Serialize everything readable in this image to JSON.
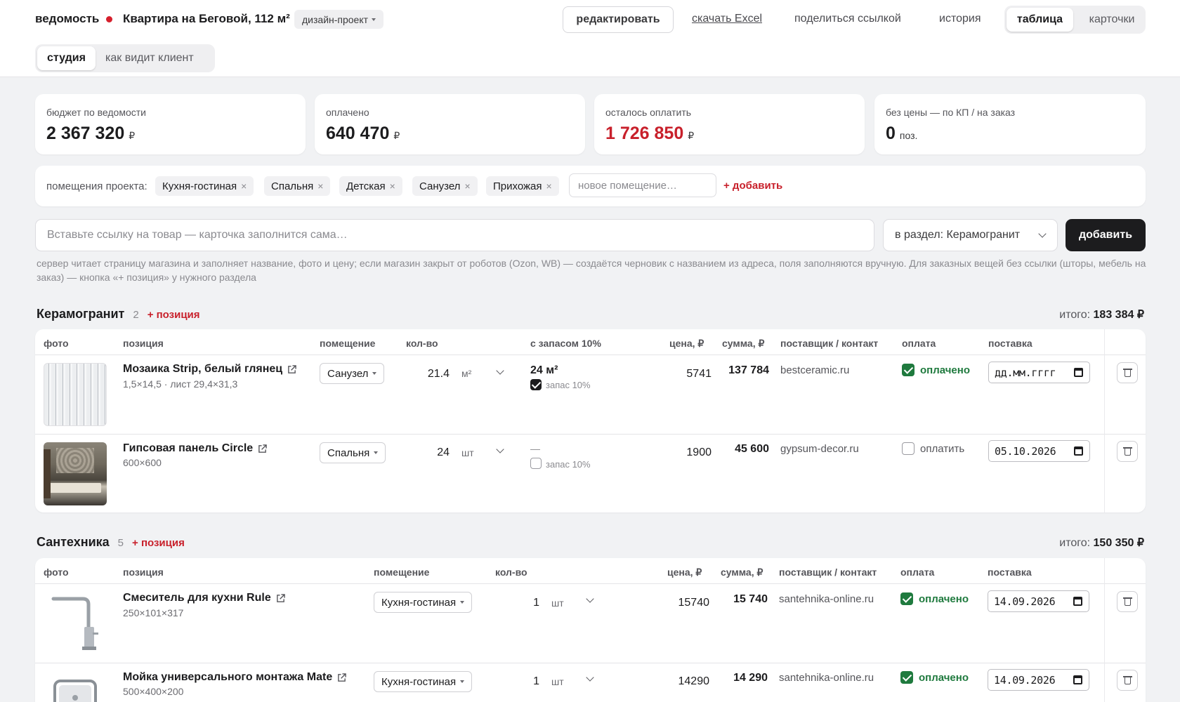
{
  "header": {
    "brand": "ведомость",
    "project_title": "Квартира на Беговой, 112 м²",
    "stage": "дизайн-проект",
    "edit_label": "редактировать",
    "excel_label": "скачать Excel",
    "share_label": "поделиться ссылкой",
    "history_label": "история",
    "view_table": "таблица",
    "view_cards": "карточки",
    "mode_studio": "студия",
    "mode_client": "как видит клиент"
  },
  "stats": [
    {
      "label": "бюджет по ведомости",
      "value": "2 367 320",
      "unit": "₽"
    },
    {
      "label": "оплачено",
      "value": "640 470",
      "unit": "₽"
    },
    {
      "label": "осталось оплатить",
      "value": "1 726 850",
      "unit": "₽"
    },
    {
      "label": "без цены — по КП / на заказ",
      "value": "0",
      "unit": "поз."
    }
  ],
  "rooms": {
    "label": "помещения проекта:",
    "items": [
      "Кухня-гостиная",
      "Спальня",
      "Детская",
      "Санузел",
      "Прихожая"
    ],
    "remove_glyph": "×",
    "new_placeholder": "новое помещение…",
    "add_label": "+ добавить"
  },
  "link_add": {
    "placeholder": "Вставьте ссылку на товар — карточка заполнится сама…",
    "section_select": "в раздел: Керамогранит",
    "add_button": "добавить",
    "hint": "сервер читает страницу магазина и заполняет название, фото и цену; если магазин закрыт от роботов (Ozon, WB) — создаётся черновик с названием из адреса, поля заполняются вручную. Для заказных вещей без ссылки (шторы, мебель на заказ) — кнопка «+ позиция» у нужного раздела"
  },
  "sections": [
    {
      "name": "Керамогранит",
      "count": "2",
      "add_label": "+ позиция",
      "total_label": "итого:",
      "total_value": "183 384 ₽",
      "columns": {
        "photo": "фото",
        "item": "позиция",
        "room": "помещение",
        "qty": "кол-во",
        "reserve": "с запасом 10%",
        "price": "цена, ₽",
        "sum": "сумма, ₽",
        "supplier": "поставщик / контакт",
        "payment": "оплата",
        "delivery": "поставка"
      },
      "rows": [
        {
          "name": "Мозаика Strip, белый глянец",
          "sub": "1,5×14,5 · лист 29,4×31,3",
          "room": "Санузел",
          "qty": "21.4",
          "unit": "м²",
          "reserve": "24 м²",
          "reserve_label": "запас 10%",
          "reserve_checked": true,
          "price": "5741",
          "sum": "137 784",
          "supplier": "bestceramic.ru",
          "paid": true,
          "pay_label": "оплачено",
          "date": "дд.мм.гггг"
        },
        {
          "name": "Гипсовая панель Circle",
          "sub": "600×600",
          "room": "Спальня",
          "qty": "24",
          "unit": "шт",
          "reserve": "—",
          "reserve_label": "запас 10%",
          "reserve_checked": false,
          "price": "1900",
          "sum": "45 600",
          "supplier": "gypsum-decor.ru",
          "paid": false,
          "pay_label": "оплатить",
          "date": "05.10.2026"
        }
      ]
    },
    {
      "name": "Сантехника",
      "count": "5",
      "add_label": "+ позиция",
      "total_label": "итого:",
      "total_value": "150 350 ₽",
      "columns": {
        "photo": "фото",
        "item": "позиция",
        "room": "помещение",
        "qty": "кол-во",
        "price": "цена, ₽",
        "sum": "сумма, ₽",
        "supplier": "поставщик / контакт",
        "payment": "оплата",
        "delivery": "поставка"
      },
      "rows": [
        {
          "name": "Смеситель для кухни Rule",
          "sub": "250×101×317",
          "room": "Кухня-гостиная",
          "qty": "1",
          "unit": "шт",
          "price": "15740",
          "sum": "15 740",
          "supplier": "santehnika-online.ru",
          "paid": true,
          "pay_label": "оплачено",
          "date": "14.09.2026"
        },
        {
          "name": "Мойка универсального монтажа Mate",
          "sub": "500×400×200",
          "room": "Кухня-гостиная",
          "qty": "1",
          "unit": "шт",
          "price": "14290",
          "sum": "14 290",
          "supplier": "santehnika-online.ru",
          "paid": true,
          "pay_label": "оплачено",
          "date": "14.09.2026"
        }
      ]
    }
  ],
  "colors": {
    "accent_red": "#c8202b",
    "paid_green": "#1f7a3e",
    "dark": "#1c1c1e"
  },
  "icons": [
    "red-dot-icon",
    "chevron-down-icon",
    "external-link-icon",
    "calendar-icon",
    "trash-icon",
    "checkbox-icon",
    "close-icon"
  ]
}
